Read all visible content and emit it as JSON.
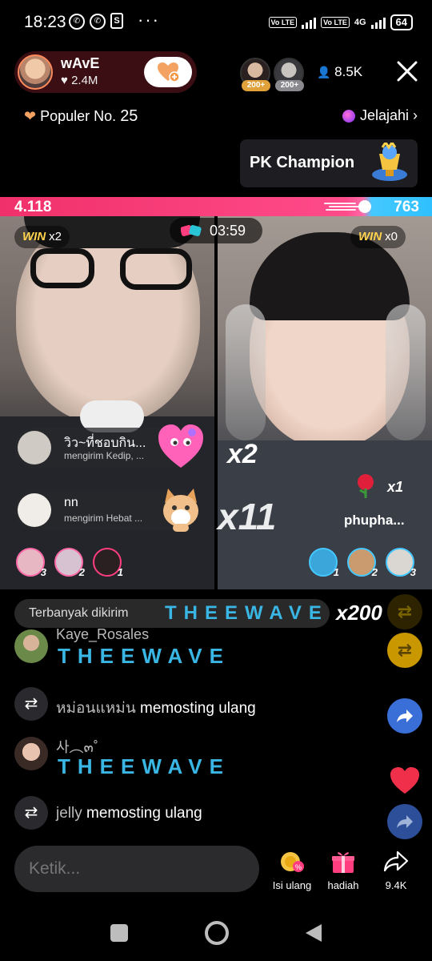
{
  "status_bar": {
    "time": "18:23",
    "notifications": [
      "whatsapp-icon",
      "whatsapp-icon",
      "shopping-bag-icon"
    ],
    "more": "···",
    "sim1": "Vo LTE",
    "sim2": "Vo LTE",
    "network": "4G",
    "battery": "64"
  },
  "host": {
    "name": "wAvE",
    "likes": "♥ 2.4M",
    "follow_icon": "heart-plus-icon"
  },
  "viewers": {
    "badges": [
      "200+",
      "200+"
    ],
    "count": "8.5K"
  },
  "ranking": {
    "label": "Populer No.",
    "number": "25",
    "explore": "Jelajahi"
  },
  "pk_champion": {
    "label": "PK Champion"
  },
  "battle": {
    "score_left": "4.118",
    "score_right": "763",
    "timer": "03:59",
    "left_wins_label": "WIN",
    "left_wins": "x2",
    "right_wins_label": "WIN",
    "right_wins": "x0"
  },
  "gifts_left": [
    {
      "name": "วิว~ที่ชอบกิน...",
      "sub": "mengirim Kedip, ..."
    },
    {
      "name": "nn",
      "sub": "mengirim Hebat ..."
    }
  ],
  "left_multipliers": {
    "top": "x2",
    "bottom": "x11"
  },
  "gift_right": {
    "name": "phupha...",
    "count": "x1"
  },
  "rank_left": [
    "3",
    "2",
    "1"
  ],
  "rank_right": [
    "1",
    "2",
    "3"
  ],
  "top_sender": {
    "label": "Terbanyak dikirim",
    "brand": "THEEWAVE",
    "multiplier": "x200"
  },
  "chat": [
    {
      "type": "comment",
      "user": "Kaye_Rosales",
      "text": "THEEWAVE"
    },
    {
      "type": "repost",
      "user": "หม่อนแหม่น",
      "text": "memosting ulang"
    },
    {
      "type": "comment",
      "user": "사︵๓˚",
      "text": "THEEWAVE"
    },
    {
      "type": "repost",
      "user": "jelly",
      "text": "memosting ulang"
    }
  ],
  "bottom": {
    "input_placeholder": "Ketik...",
    "topup": "Isi ulang",
    "gift": "hadiah",
    "share_count": "9.4K"
  },
  "colors": {
    "accent_pink": "#f0306a",
    "accent_blue": "#2ec0ff",
    "wave_text": "#39b6e4",
    "win_gold": "#ffd34d"
  }
}
